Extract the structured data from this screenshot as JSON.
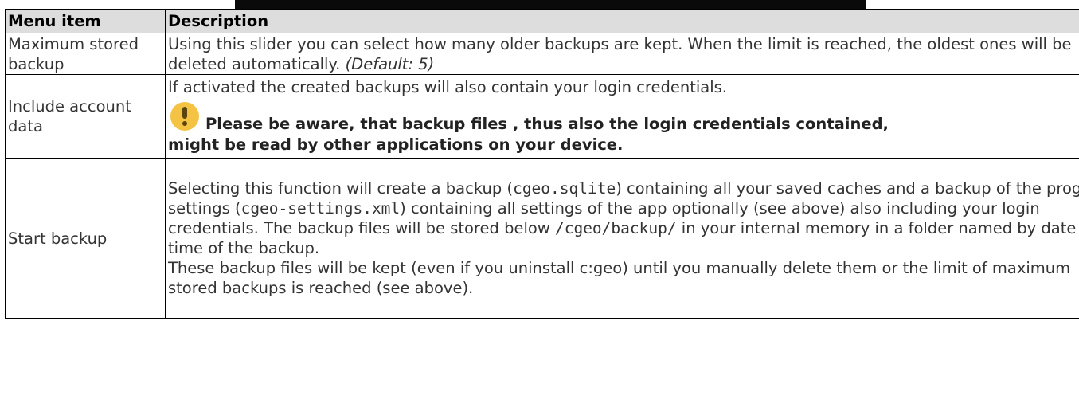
{
  "table": {
    "headers": {
      "menu_item": "Menu item",
      "description": "Description"
    },
    "rows": [
      {
        "menu_item": "Maximum stored backup",
        "text_1": "Using this slider you can select how many older backups are kept. When the limit is reached, the oldest ones will be deleted automatically. ",
        "default_note": "(Default: 5)"
      },
      {
        "menu_item": "Include account data",
        "text_1": "If activated the created backups will also contain your login credentials.",
        "warning_icon": "exclamation-warning-icon",
        "warning_line_1": "Please be aware, that backup files , thus also the login credentials contained,",
        "warning_line_2": "might be read by other applications on your device."
      },
      {
        "menu_item": "Start backup",
        "text_1": "Selecting this function will create a backup (",
        "code_1": "cgeo.sqlite",
        "text_2": ") containing all your saved caches and a backup of the program settings (",
        "code_2": "cgeo-settings.xml",
        "text_3": ") containing all settings of the app optionally (see above) also including your login credentials. The backup files will be stored below ",
        "code_3": "/cgeo/backup/",
        "text_4": " in your internal memory in a folder named by date and time of the backup.",
        "text_5": "These backup files will be kept (even if you uninstall c:geo) until you manually delete them or the limit of maximum stored backups is reached (see above)."
      }
    ]
  },
  "colors": {
    "header_bg": "#dddddd",
    "border": "#000000",
    "warning_icon": "#f5c344"
  }
}
